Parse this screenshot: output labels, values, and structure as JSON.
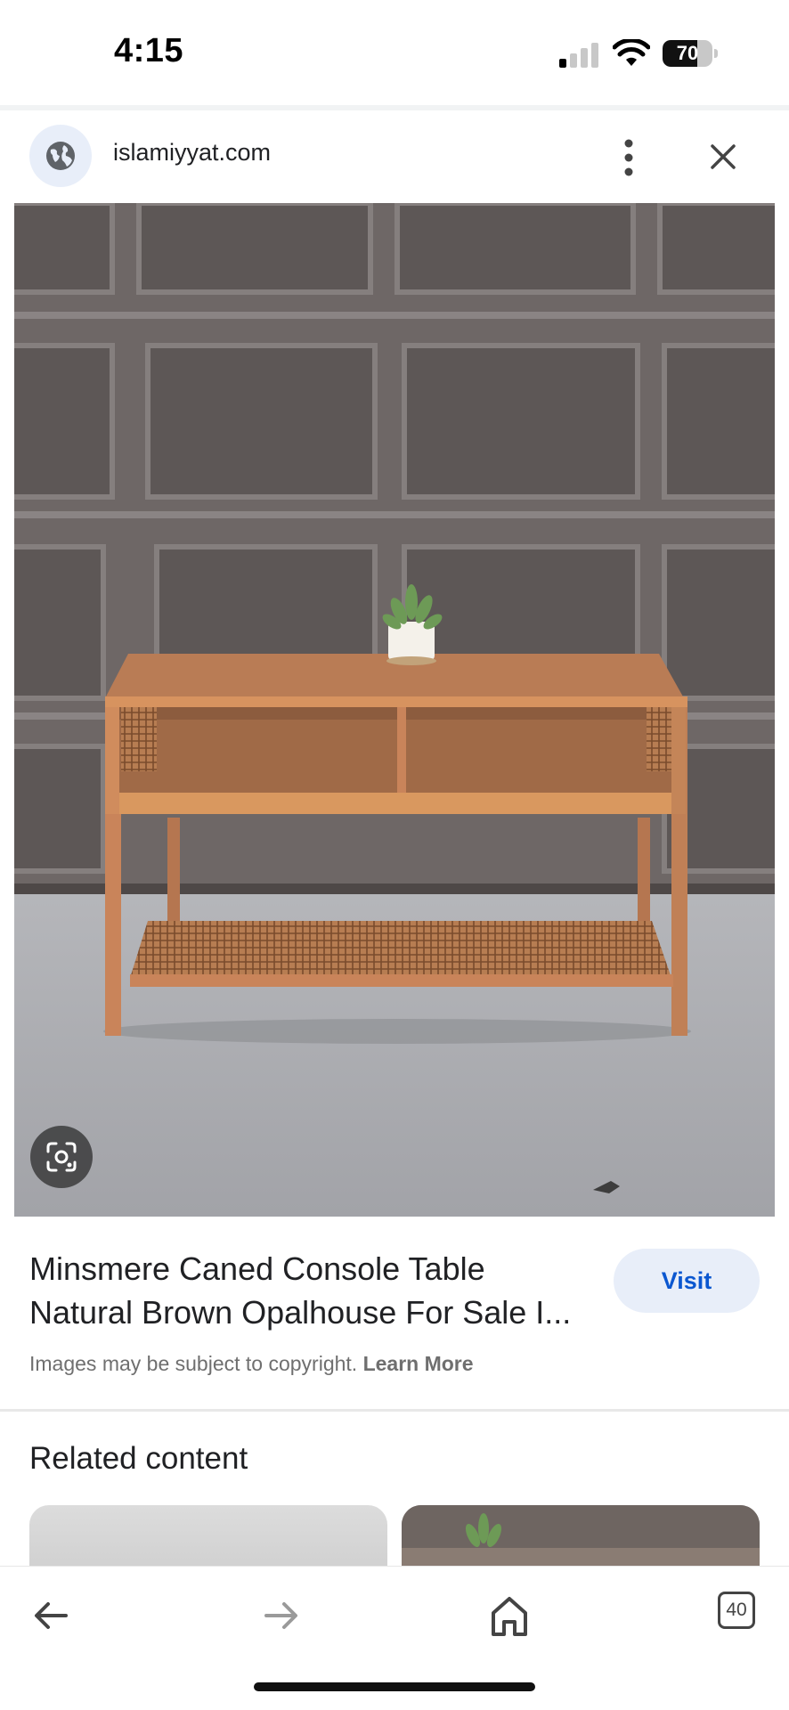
{
  "status_bar": {
    "time": "4:15",
    "battery": "70",
    "battery_level": 0.7,
    "signal_bars_active": 1
  },
  "site": {
    "domain": "islamiyyat.com",
    "favicon_icon": "globe-icon"
  },
  "image": {
    "lens_icon": "lens-icon"
  },
  "result": {
    "title_line1": "Minsmere Caned Console Table",
    "title_line2": "Natural Brown Opalhouse For Sale I...",
    "visit_label": "Visit",
    "copyright_text": "Images may be subject to copyright.",
    "learn_more_label": "Learn More"
  },
  "related": {
    "heading": "Related content"
  },
  "bottom_nav": {
    "tab_count": "40"
  },
  "colors": {
    "accent": "#0b57d0",
    "visit_bg": "#e8eef9",
    "wood": "#c98a5f",
    "garage_door": "#6e6766",
    "concrete": "#a9a9ad"
  }
}
